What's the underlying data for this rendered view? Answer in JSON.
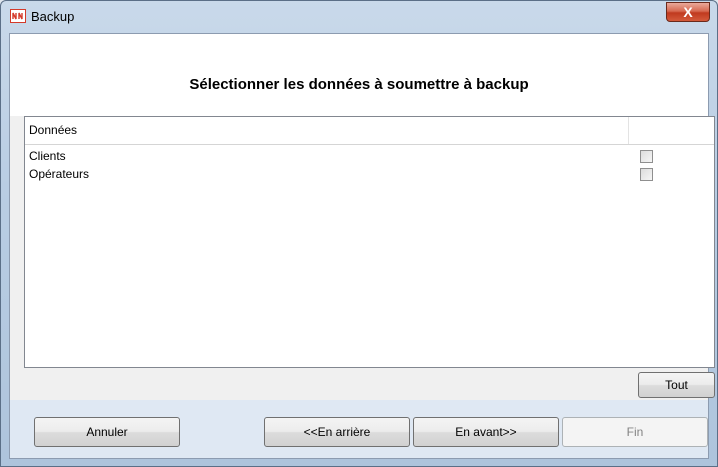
{
  "window": {
    "title": "Backup",
    "close_glyph": "X",
    "icon": "app-logo-icon"
  },
  "header": {
    "heading": "Sélectionner les données à soumettre à backup"
  },
  "grid": {
    "column_header": "Données",
    "rows": [
      {
        "label": "Clients",
        "checked": false
      },
      {
        "label": "Opérateurs",
        "checked": false
      }
    ]
  },
  "buttons": {
    "all": "Tout",
    "cancel": "Annuler",
    "back": "<<En arrière",
    "next": "En avant>>",
    "finish": "Fin"
  }
}
